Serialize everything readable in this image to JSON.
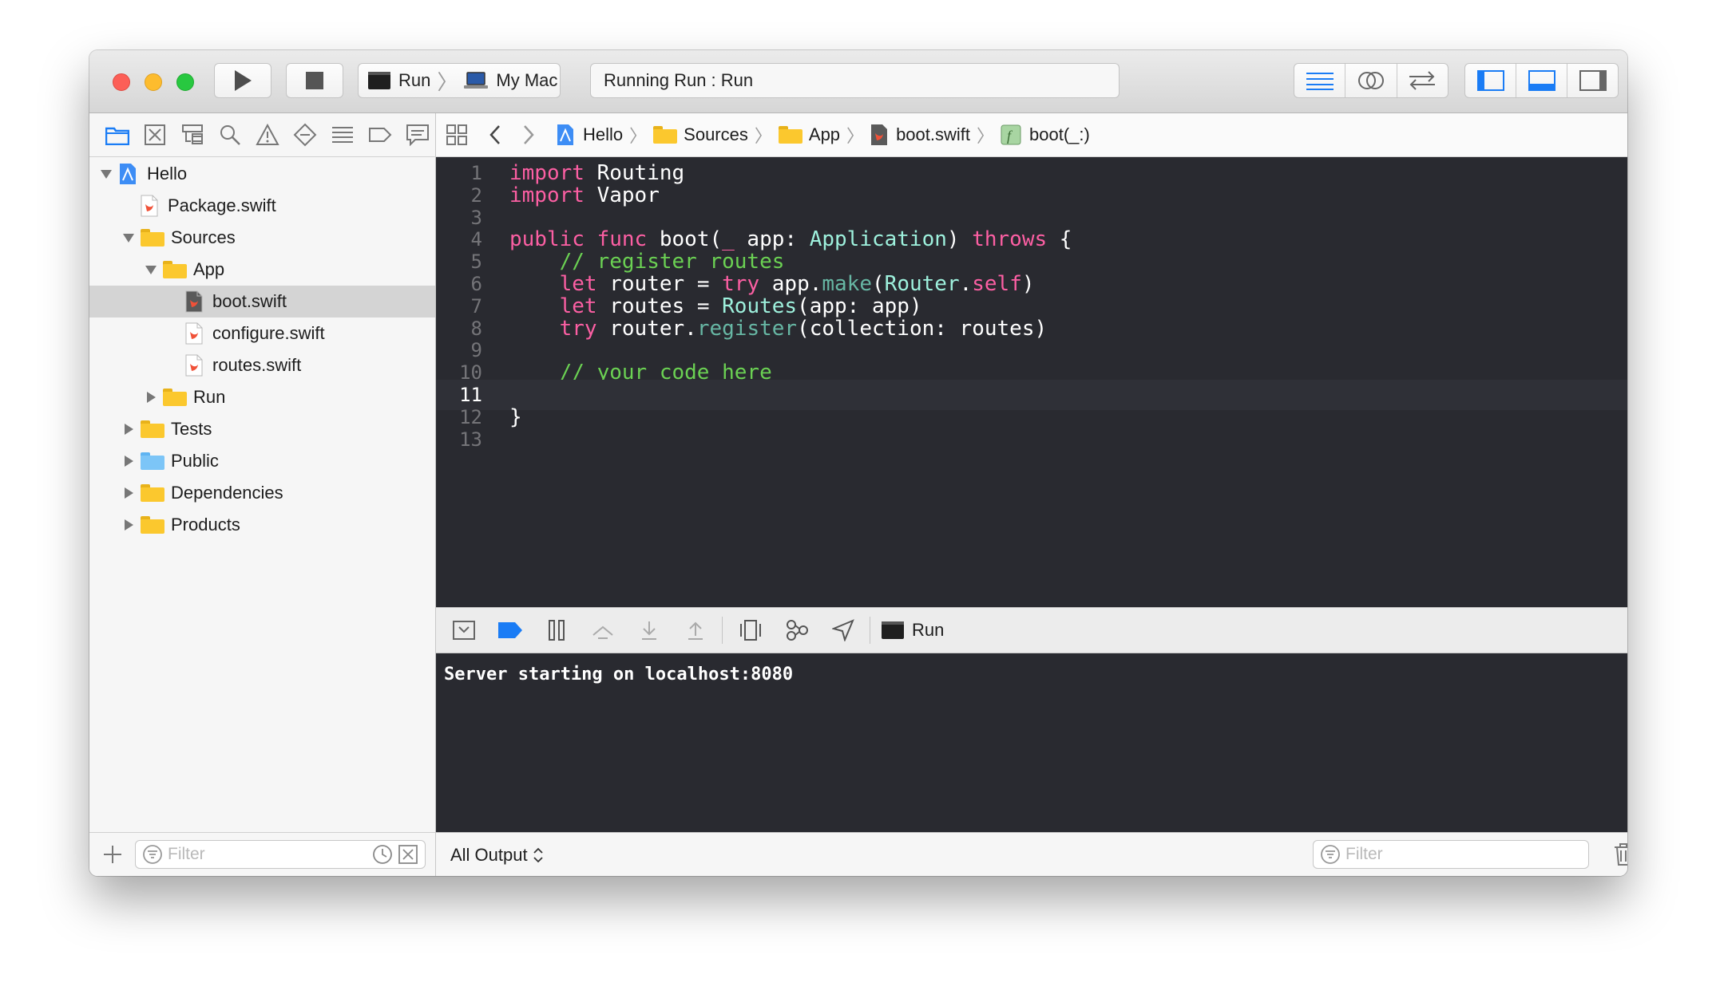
{
  "toolbar": {
    "scheme_target": "Run",
    "scheme_device": "My Mac",
    "activity": "Running Run : Run"
  },
  "navigator": {
    "items": [
      {
        "label": "Hello",
        "kind": "project",
        "depth": 0,
        "disclosure": "open"
      },
      {
        "label": "Package.swift",
        "kind": "swift",
        "depth": 1,
        "disclosure": "none"
      },
      {
        "label": "Sources",
        "kind": "folder",
        "depth": 1,
        "disclosure": "open"
      },
      {
        "label": "App",
        "kind": "folder",
        "depth": 2,
        "disclosure": "open"
      },
      {
        "label": "boot.swift",
        "kind": "swift",
        "depth": 3,
        "disclosure": "none",
        "selected": true
      },
      {
        "label": "configure.swift",
        "kind": "swift",
        "depth": 3,
        "disclosure": "none"
      },
      {
        "label": "routes.swift",
        "kind": "swift",
        "depth": 3,
        "disclosure": "none"
      },
      {
        "label": "Run",
        "kind": "folder",
        "depth": 2,
        "disclosure": "closed"
      },
      {
        "label": "Tests",
        "kind": "folder",
        "depth": 1,
        "disclosure": "closed"
      },
      {
        "label": "Public",
        "kind": "folder-blue",
        "depth": 1,
        "disclosure": "closed"
      },
      {
        "label": "Dependencies",
        "kind": "folder",
        "depth": 1,
        "disclosure": "closed"
      },
      {
        "label": "Products",
        "kind": "folder",
        "depth": 1,
        "disclosure": "closed"
      }
    ],
    "filter_placeholder": "Filter"
  },
  "jumpbar": {
    "crumbs": [
      "Hello",
      "Sources",
      "App",
      "boot.swift",
      "boot(_:)"
    ]
  },
  "editor": {
    "current_line": 11,
    "lines": [
      [
        [
          "kw",
          "import"
        ],
        [
          "pl",
          " Routing"
        ]
      ],
      [
        [
          "kw",
          "import"
        ],
        [
          "pl",
          " Vapor"
        ]
      ],
      [],
      [
        [
          "kw",
          "public"
        ],
        [
          "pl",
          " "
        ],
        [
          "kw",
          "func"
        ],
        [
          "pl",
          " boot("
        ],
        [
          "kw",
          "_"
        ],
        [
          "pl",
          " app: "
        ],
        [
          "ty",
          "Application"
        ],
        [
          "pl",
          ") "
        ],
        [
          "kw",
          "throws"
        ],
        [
          "pl",
          " {"
        ]
      ],
      [
        [
          "pl",
          "    "
        ],
        [
          "cm",
          "// register routes"
        ]
      ],
      [
        [
          "pl",
          "    "
        ],
        [
          "kw",
          "let"
        ],
        [
          "pl",
          " router = "
        ],
        [
          "kw",
          "try"
        ],
        [
          "pl",
          " app."
        ],
        [
          "fn",
          "make"
        ],
        [
          "pl",
          "("
        ],
        [
          "ty",
          "Router"
        ],
        [
          "pl",
          "."
        ],
        [
          "kw",
          "self"
        ],
        [
          "pl",
          ")"
        ]
      ],
      [
        [
          "pl",
          "    "
        ],
        [
          "kw",
          "let"
        ],
        [
          "pl",
          " routes = "
        ],
        [
          "ty",
          "Routes"
        ],
        [
          "pl",
          "(app: app)"
        ]
      ],
      [
        [
          "pl",
          "    "
        ],
        [
          "kw",
          "try"
        ],
        [
          "pl",
          " router."
        ],
        [
          "fn",
          "register"
        ],
        [
          "pl",
          "(collection: routes)"
        ]
      ],
      [],
      [
        [
          "pl",
          "    "
        ],
        [
          "cm",
          "// your code here"
        ]
      ],
      [],
      [
        [
          "pl",
          "}"
        ]
      ],
      []
    ]
  },
  "debug": {
    "process_label": "Run"
  },
  "console": {
    "output": "Server starting on localhost:8080",
    "scope_label": "All Output",
    "filter_placeholder": "Filter"
  },
  "colors": {
    "editor_bg": "#292a30",
    "keyword": "#fc5fa3",
    "comment": "#6bd153",
    "type": "#9ef1dd",
    "function": "#67b7a4",
    "accent": "#1a7cf5"
  }
}
